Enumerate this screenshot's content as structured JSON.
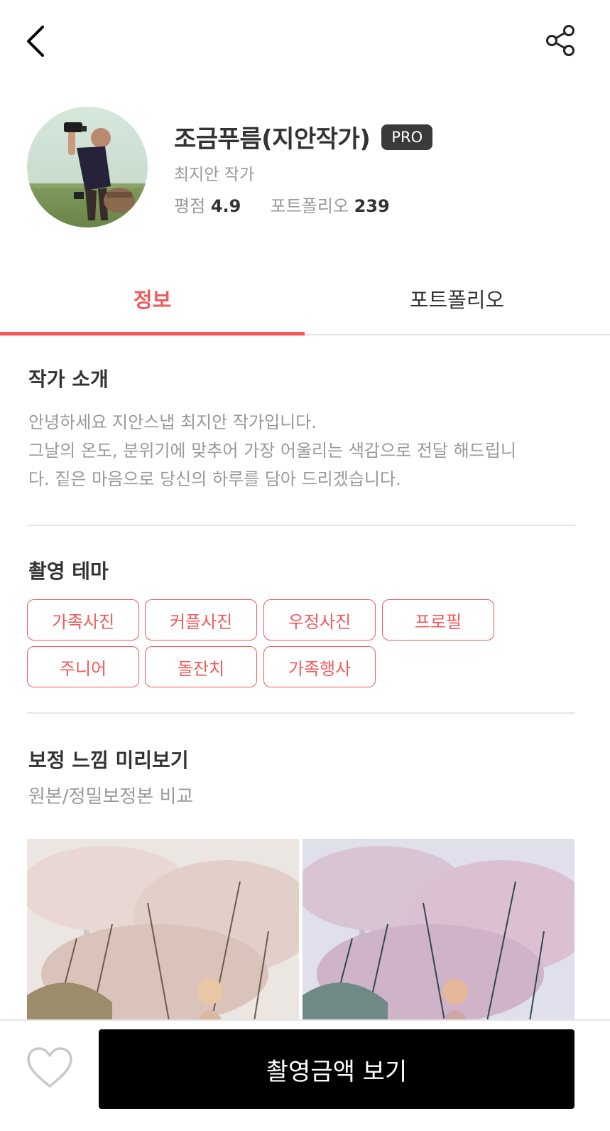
{
  "profile": {
    "name": "조금푸름(지안작가)",
    "badge": "PRO",
    "subtitle": "최지안 작가",
    "rating_label": "평점",
    "rating_value": "4.9",
    "portfolio_label": "포트폴리오",
    "portfolio_count": "239"
  },
  "tabs": [
    {
      "label": "정보",
      "active": true
    },
    {
      "label": "포트폴리오",
      "active": false
    }
  ],
  "intro": {
    "title": "작가 소개",
    "lines": [
      "안녕하세요 지안스냅 최지안 작가입니다.",
      "그날의 온도, 분위기에 맞추어 가장 어울리는 색감으로 전달 해드립니",
      "다. 짙은 마음으로 당신의 하루를 담아 드리겠습니다."
    ]
  },
  "themes": {
    "title": "촬영 테마",
    "items": [
      "가족사진",
      "커플사진",
      "우정사진",
      "프로필",
      "주니어",
      "돌잔치",
      "가족행사"
    ]
  },
  "preview": {
    "title": "보정 느낌 미리보기",
    "subtitle": "원본/정밀보정본 비교"
  },
  "bottom": {
    "cta_label": "촬영금액 보기"
  },
  "icons": {
    "back": "chevron-left-icon",
    "share": "share-icon",
    "heart": "heart-outline-icon"
  },
  "colors": {
    "accent": "#f15a5a",
    "badge_bg": "#3a3a3a",
    "cta_bg": "#000000",
    "muted_text": "#999999",
    "primary_text": "#333333"
  }
}
